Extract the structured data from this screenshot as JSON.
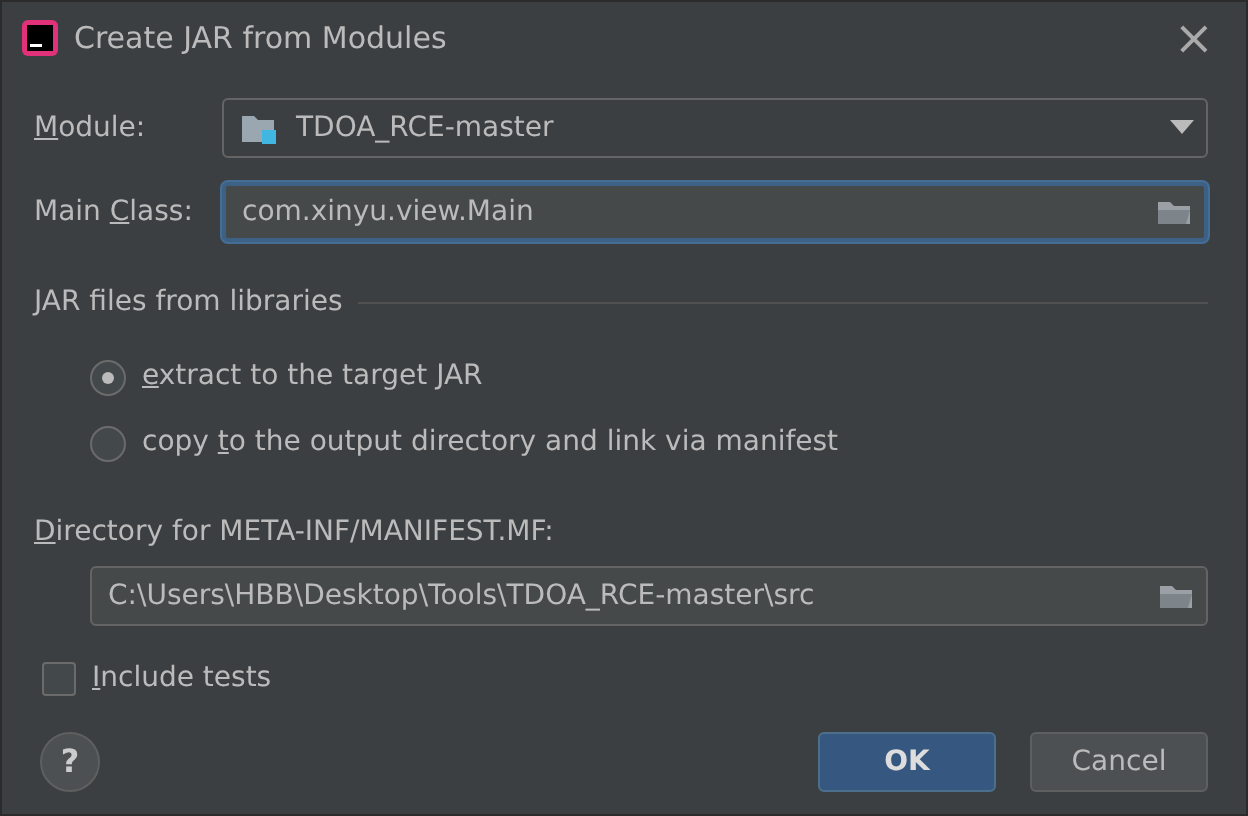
{
  "window": {
    "title": "Create JAR from Modules",
    "close": "×"
  },
  "module": {
    "label": {
      "key": "M",
      "post": "odule:"
    },
    "value": "TDOA_RCE-master"
  },
  "main_class": {
    "label": {
      "pre": "Main ",
      "key": "C",
      "post": "lass:"
    },
    "value": "com.xinyu.view.Main",
    "focused": true
  },
  "libraries": {
    "title": "JAR files from libraries",
    "options": [
      {
        "label": {
          "key": "e",
          "post": "xtract to the target JAR"
        },
        "selected": true
      },
      {
        "label": {
          "pre": "copy ",
          "key": "t",
          "post": "o the output directory and link via manifest"
        },
        "selected": false
      }
    ]
  },
  "manifest_dir": {
    "label": {
      "key": "D",
      "post": "irectory for META-INF/MANIFEST.MF:"
    },
    "value": "C:\\Users\\HBB\\Desktop\\Tools\\TDOA_RCE-master\\src"
  },
  "include_tests": {
    "label": {
      "key": "I",
      "post": "nclude tests"
    },
    "checked": false
  },
  "help": "?",
  "buttons": [
    {
      "label": "OK",
      "kind": "primary"
    },
    {
      "label": "Cancel",
      "kind": "secondary"
    }
  ]
}
